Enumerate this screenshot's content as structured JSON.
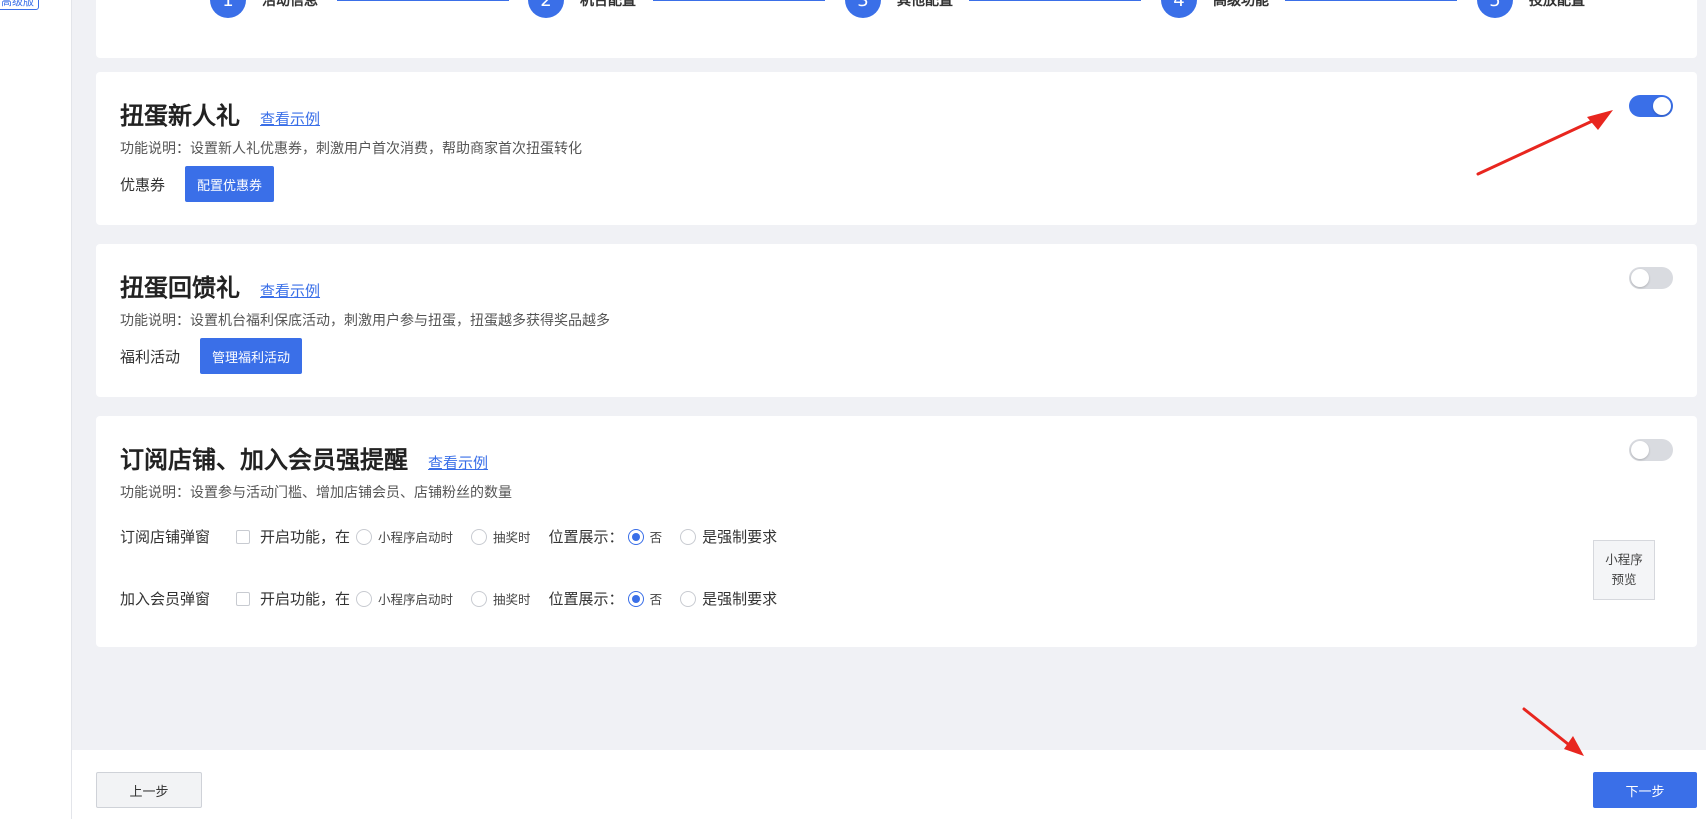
{
  "sidebar": {
    "badge": "高级版"
  },
  "steps": [
    {
      "num": "1",
      "label": "活动信息"
    },
    {
      "num": "2",
      "label": "机台配置"
    },
    {
      "num": "3",
      "label": "其他配置"
    },
    {
      "num": "4",
      "label": "高级功能"
    },
    {
      "num": "5",
      "label": "投放配置"
    }
  ],
  "cards": {
    "newcomer": {
      "title": "扭蛋新人礼",
      "link": "查看示例",
      "desc": "功能说明：设置新人礼优惠券，刺激用户首次消费，帮助商家首次扭蛋转化",
      "row_label": "优惠券",
      "button": "配置优惠券",
      "enabled": true
    },
    "feedback": {
      "title": "扭蛋回馈礼",
      "link": "查看示例",
      "desc": "功能说明：设置机台福利保底活动，刺激用户参与扭蛋，扭蛋越多获得奖品越多",
      "row_label": "福利活动",
      "button": "管理福利活动",
      "enabled": false
    },
    "subscribe": {
      "title": "订阅店铺、加入会员强提醒",
      "link": "查看示例",
      "desc": "功能说明：设置参与活动门槛、增加店铺会员、店铺粉丝的数量",
      "enabled": false,
      "rows": [
        {
          "label": "订阅店铺弹窗",
          "enable_text": "开启功能，在",
          "opt1": "小程序启动时",
          "opt2": "抽奖时",
          "pos_label": "位置展示：",
          "pos_no": "否",
          "pos_force": "是强制要求"
        },
        {
          "label": "加入会员弹窗",
          "enable_text": "开启功能，在",
          "opt1": "小程序启动时",
          "opt2": "抽奖时",
          "pos_label": "位置展示：",
          "pos_no": "否",
          "pos_force": "是强制要求"
        }
      ],
      "preview_line1": "小程序",
      "preview_line2": "预览"
    }
  },
  "footer": {
    "prev": "上一步",
    "next": "下一步"
  },
  "colors": {
    "accent": "#3a6fe8",
    "annotation": "#e8261f"
  }
}
